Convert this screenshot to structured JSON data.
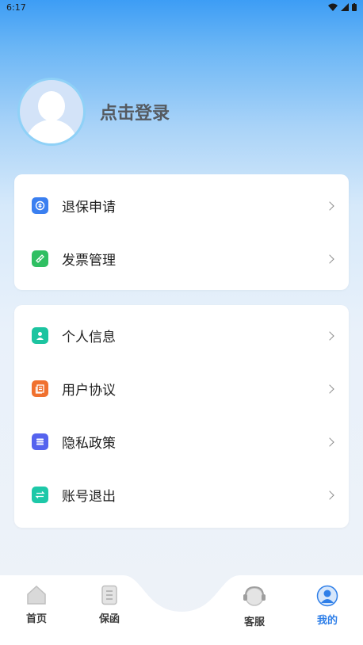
{
  "status_bar": {
    "time": "6:17"
  },
  "profile": {
    "login_label": "点击登录"
  },
  "menu_group1": [
    {
      "label": "退保申请",
      "icon": "refund-doc-icon",
      "color": "#3a7ff0"
    },
    {
      "label": "发票管理",
      "icon": "invoice-icon",
      "color": "#2fbf62"
    }
  ],
  "menu_group2": [
    {
      "label": "个人信息",
      "icon": "person-card-icon",
      "color": "#1cc4a0"
    },
    {
      "label": "用户协议",
      "icon": "agreement-icon",
      "color": "#f0712f"
    },
    {
      "label": "隐私政策",
      "icon": "privacy-list-icon",
      "color": "#5563ee"
    },
    {
      "label": "账号退出",
      "icon": "exchange-arrows-icon",
      "color": "#1dc8a8"
    }
  ],
  "tabs": [
    {
      "label": "首页",
      "icon": "home-icon",
      "active": false
    },
    {
      "label": "保函",
      "icon": "document-icon",
      "active": false
    },
    {
      "label": "客服",
      "icon": "headset-icon",
      "active": false
    },
    {
      "label": "我的",
      "icon": "user-icon",
      "active": true
    }
  ],
  "colors": {
    "accent": "#2f7fe8",
    "header_blue": "#3d9df5"
  }
}
